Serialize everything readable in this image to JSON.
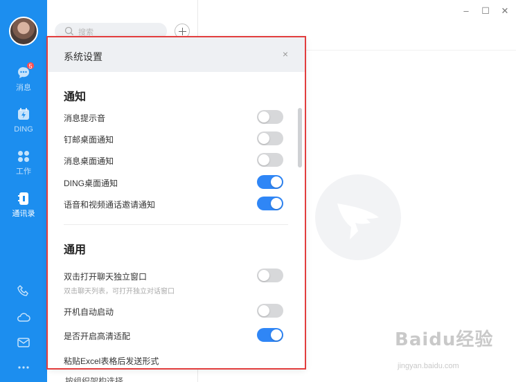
{
  "nav": {
    "badge": "5",
    "items": [
      {
        "label": "消息",
        "icon": "chat-icon"
      },
      {
        "label": "DING",
        "icon": "ding-icon"
      },
      {
        "label": "工作",
        "icon": "apps-icon"
      },
      {
        "label": "通讯录",
        "icon": "contacts-icon"
      }
    ],
    "bottom_icons": [
      "phone-icon",
      "cloud-icon",
      "mail-icon",
      "more-icon"
    ]
  },
  "search": {
    "placeholder": "搜索"
  },
  "middle": {
    "partial_item": "按组织架构选择"
  },
  "window": {
    "minimize": "–",
    "maximize": "☐",
    "close": "✕"
  },
  "dialog": {
    "title": "系统设置",
    "close": "×",
    "sections": {
      "notify": {
        "title": "通知",
        "rows": [
          {
            "label": "消息提示音",
            "on": false
          },
          {
            "label": "钉邮桌面通知",
            "on": false
          },
          {
            "label": "消息桌面通知",
            "on": false
          },
          {
            "label": "DING桌面通知",
            "on": true
          },
          {
            "label": "语音和视频通话邀请通知",
            "on": true
          }
        ]
      },
      "general": {
        "title": "通用",
        "rows": [
          {
            "label": "双击打开聊天独立窗口",
            "desc": "双击聊天列表，可打开独立对话窗口",
            "on": false
          },
          {
            "label": "开机自动启动",
            "on": false
          },
          {
            "label": "是否开启高清适配",
            "on": true
          },
          {
            "label": "粘贴Excel表格后发送形式"
          }
        ]
      }
    }
  },
  "watermark": {
    "brand": "Baidu经验",
    "url": "jingyan.baidu.com"
  },
  "colors": {
    "nav_bg": "#1c8eef",
    "toggle_on": "#2f86f6",
    "toggle_off": "#d7d8da",
    "highlight_frame": "#e23d3d"
  }
}
